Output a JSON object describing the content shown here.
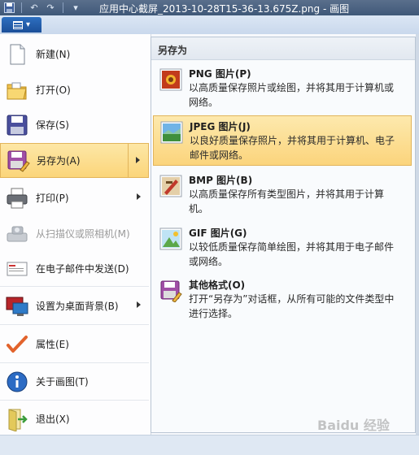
{
  "window": {
    "title": "应用中心截屏_2013-10-28T15-36-13.675Z.png - 画图"
  },
  "quick_access": {
    "save_icon": "floppy-icon",
    "undo": "↶",
    "redo": "↷",
    "customize": "▾"
  },
  "app_button": {
    "arrow": "▾"
  },
  "left_menu": {
    "items": [
      {
        "label": "新建(N)",
        "icon": "new-document-icon"
      },
      {
        "label": "打开(O)",
        "icon": "open-folder-icon"
      },
      {
        "label": "保存(S)",
        "icon": "save-floppy-icon"
      },
      {
        "label": "另存为(A)",
        "icon": "save-as-icon",
        "submenu": true,
        "highlighted": true
      },
      {
        "label": "打印(P)",
        "icon": "printer-icon",
        "submenu": true
      },
      {
        "label": "从扫描仪或照相机(M)",
        "icon": "scanner-icon",
        "disabled": true
      },
      {
        "label": "在电子邮件中发送(D)",
        "icon": "email-icon"
      },
      {
        "label": "设置为桌面背景(B)",
        "icon": "desktop-icon",
        "submenu": true
      },
      {
        "label": "属性(E)",
        "icon": "checkmark-icon"
      },
      {
        "label": "关于画图(T)",
        "icon": "info-icon"
      },
      {
        "label": "退出(X)",
        "icon": "exit-icon"
      }
    ]
  },
  "submenu": {
    "header": "另存为",
    "items": [
      {
        "title": "PNG 图片(P)",
        "desc": "以高质量保存照片或绘图，并将其用于计算机或网络。",
        "icon": "png-image-icon"
      },
      {
        "title": "JPEG 图片(J)",
        "desc": "以良好质量保存照片，并将其用于计算机、电子邮件或网络。",
        "icon": "jpeg-image-icon",
        "highlighted": true
      },
      {
        "title": "BMP 图片(B)",
        "desc": "以高质量保存所有类型图片，并将其用于计算机。",
        "icon": "bmp-image-icon"
      },
      {
        "title": "GIF 图片(G)",
        "desc": "以较低质量保存简单绘图，并将其用于电子邮件或网络。",
        "icon": "gif-image-icon"
      },
      {
        "title": "其他格式(O)",
        "desc": "打开“另存为”对话框，从所有可能的文件类型中进行选择。",
        "icon": "other-formats-icon"
      }
    ]
  },
  "watermark": "Baidu 经验"
}
